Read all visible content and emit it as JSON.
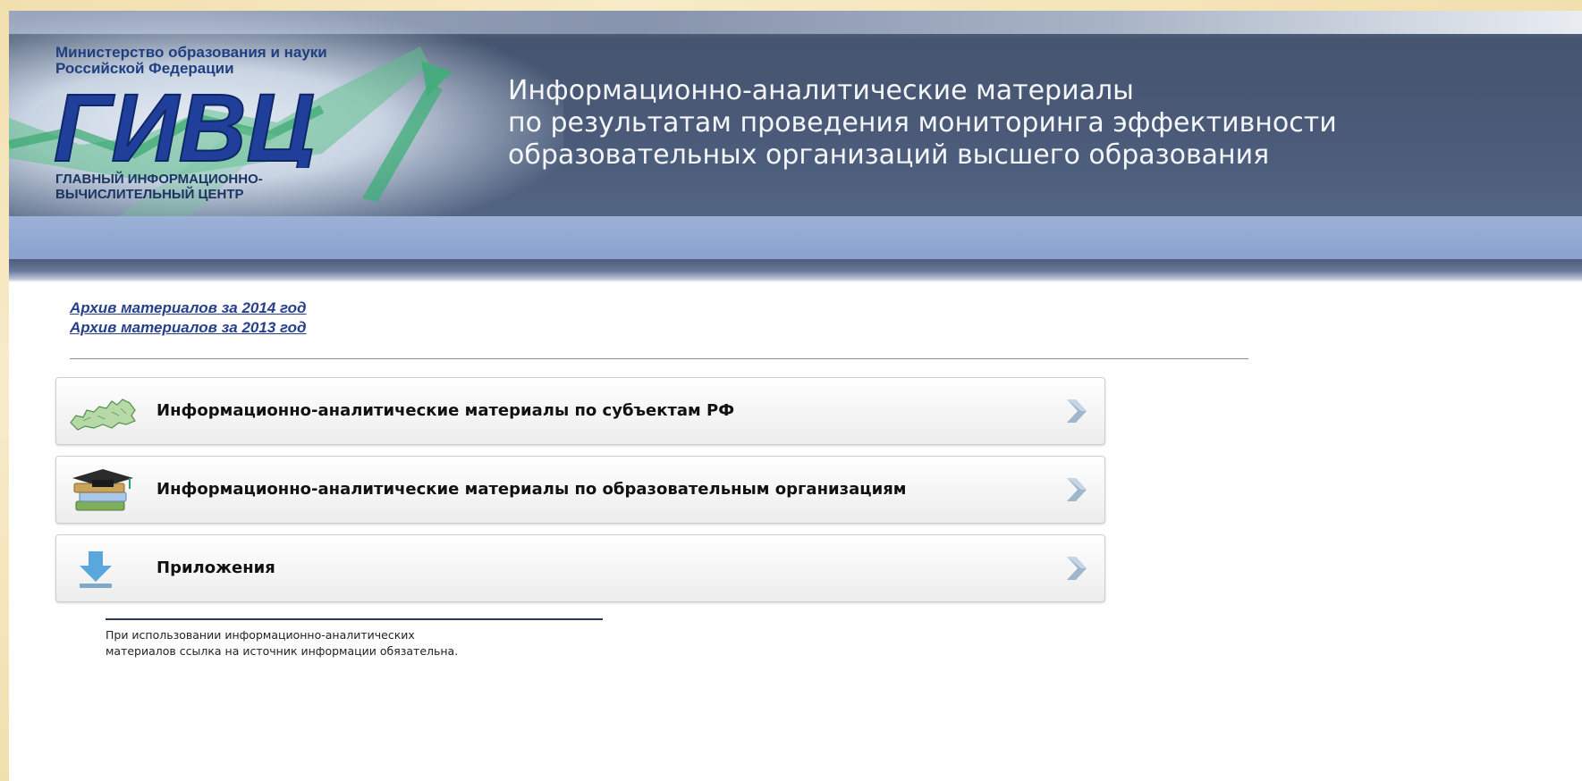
{
  "header": {
    "ministry": [
      "Министерство образования и науки",
      "Российской Федерации"
    ],
    "logo_text": "ГИВЦ",
    "center_name": [
      "ГЛАВНЫЙ ИНФОРМАЦИОННО-",
      "ВЫЧИСЛИТЕЛЬНЫЙ ЦЕНТР"
    ],
    "title_lines": [
      "Информационно-аналитические материалы",
      "по результатам проведения мониторинга эффективности",
      "образовательных организаций высшего образования"
    ]
  },
  "archive_links": [
    "Архив материалов за 2014 год",
    "Архив материалов за 2013 год"
  ],
  "menu": [
    {
      "label": "Информационно-аналитические материалы по субъектам РФ",
      "icon": "russia-map-icon"
    },
    {
      "label": "Информационно-аналитические материалы по образовательным организациям",
      "icon": "books-graduation-cap-icon"
    },
    {
      "label": "Приложения",
      "icon": "download-icon"
    }
  ],
  "footer_note": [
    "При использовании информационно-аналитических",
    "материалов ссылка на источник информации обязательна."
  ],
  "colors": {
    "header_dark": "#45556f",
    "blue_band": "#8aa2cd",
    "link": "#27408c",
    "logo_blue": "#1f3f9a",
    "accent_green": "#2fa06a"
  }
}
